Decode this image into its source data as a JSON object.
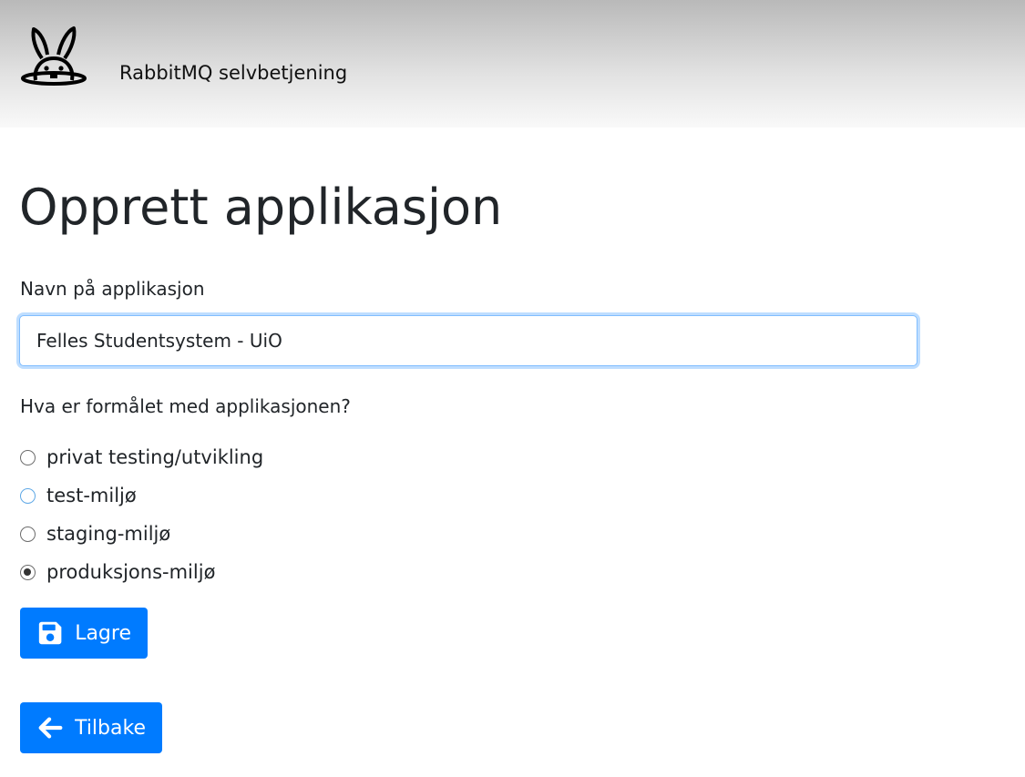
{
  "header": {
    "brand": "RabbitMQ selvbetjening",
    "logo_icon": "rabbit-icon"
  },
  "page": {
    "title": "Opprett applikasjon"
  },
  "form": {
    "name_label": "Navn på applikasjon",
    "name_value": "Felles Studentsystem - UiO",
    "purpose_label": "Hva er formålet med applikasjonen?",
    "purpose_options": [
      {
        "label": "privat testing/utvikling",
        "checked": false
      },
      {
        "label": "test-miljø",
        "checked": false
      },
      {
        "label": "staging-miljø",
        "checked": false
      },
      {
        "label": "produksjons-miljø",
        "checked": true
      }
    ],
    "save_label": "Lagre",
    "save_icon": "save-icon",
    "back_label": "Tilbake",
    "back_icon": "arrow-left-icon"
  },
  "colors": {
    "primary": "#007bff",
    "focus_border": "#80bdff"
  }
}
